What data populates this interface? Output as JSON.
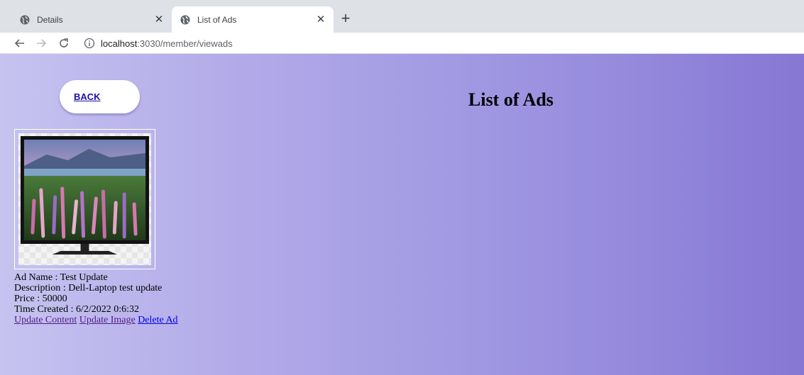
{
  "browser": {
    "tabs": [
      {
        "title": "Details",
        "active": false,
        "icon": "globe-icon"
      },
      {
        "title": "List of Ads",
        "active": true,
        "icon": "globe-icon"
      }
    ],
    "close_glyph": "✕",
    "new_tab_glyph": "+",
    "url_host": "localhost",
    "url_path": ":3030/member/viewads"
  },
  "page": {
    "back_label": "BACK",
    "title": "List of Ads",
    "gradient_colors": [
      "#c6c3f0",
      "#8677d4"
    ]
  },
  "ads": [
    {
      "name_line": "Ad Name : Test Update",
      "description_line": "Description : Dell-Laptop test update",
      "price_line": "Price : 50000",
      "time_line": "Time Created : 6/2/2022 0:6:32",
      "links": {
        "update_content": "Update Content",
        "update_image": "Update Image",
        "delete": "Delete Ad"
      },
      "image": "tv-with-flower-field-image"
    }
  ]
}
